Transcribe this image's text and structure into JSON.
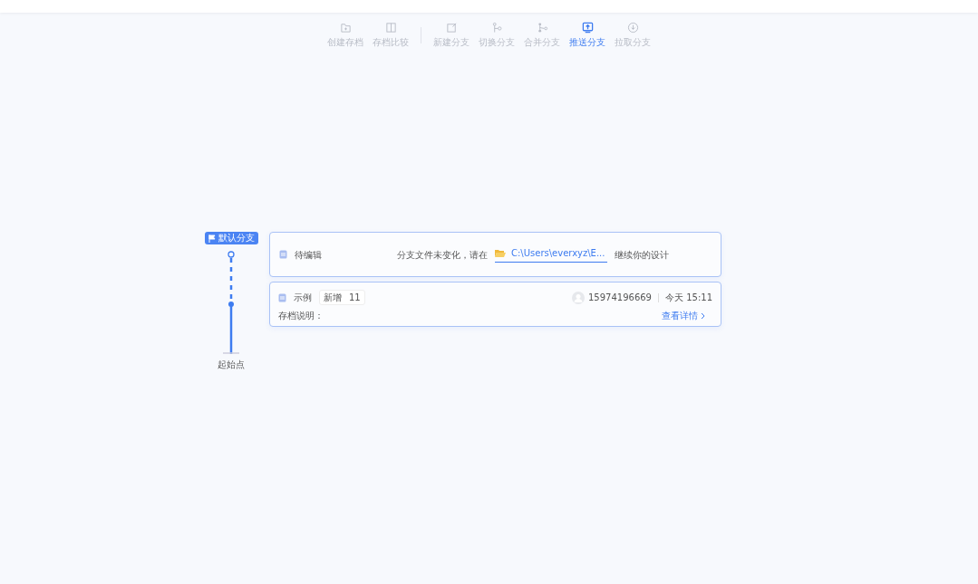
{
  "toolbar": {
    "groups": [
      [
        {
          "label": "创建存档",
          "kind": "create",
          "selected": false
        },
        {
          "label": "存档比较",
          "kind": "compare",
          "selected": false
        }
      ],
      [
        {
          "label": "新建分支",
          "kind": "new",
          "selected": false
        },
        {
          "label": "切换分支",
          "kind": "switch",
          "selected": false
        },
        {
          "label": "合并分支",
          "kind": "merge",
          "selected": false
        },
        {
          "label": "推送分支",
          "kind": "push",
          "selected": true
        },
        {
          "label": "拉取分支",
          "kind": "pull",
          "selected": false
        }
      ]
    ]
  },
  "timeline": {
    "branch_badge": "默认分支",
    "start_label": "起始点"
  },
  "cards": [
    {
      "kind": "pending",
      "title": "待编辑",
      "message_before": "分支文件未变化，请在",
      "path": "C:\\Users\\everxyz\\E...",
      "message_after": "继续你的设计"
    },
    {
      "kind": "archive",
      "title": "示例",
      "tag": "新增",
      "tag_count": "11",
      "user": "15974196669",
      "time": "今天 15:11",
      "note_label": "存档说明：",
      "details_link": "查看详情"
    }
  ]
}
